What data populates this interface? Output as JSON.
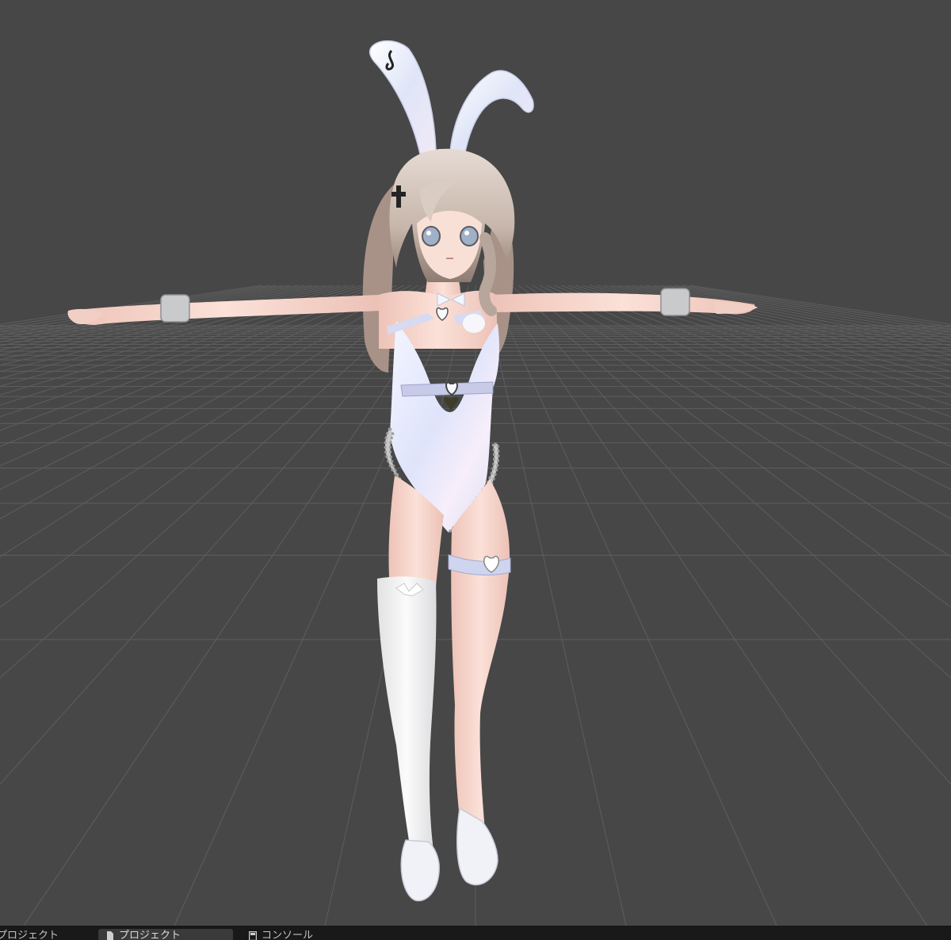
{
  "colors": {
    "viewport_background": "#474747",
    "grid_line": "#5e5e5e",
    "tabbar_background": "#191919",
    "tab_active_background": "#3a3a3a",
    "skin": "#f6d6cc",
    "hair": "#cbbbb1",
    "outfit": "#eef0fb",
    "accent": "#c7cbe8"
  },
  "tabs": [
    {
      "label": "プロジェクト",
      "icon": "folder-icon",
      "active": false
    },
    {
      "label": "プロジェクト",
      "icon": "folder-icon",
      "active": true
    },
    {
      "label": "コンソール",
      "icon": "console-icon",
      "active": false
    }
  ]
}
